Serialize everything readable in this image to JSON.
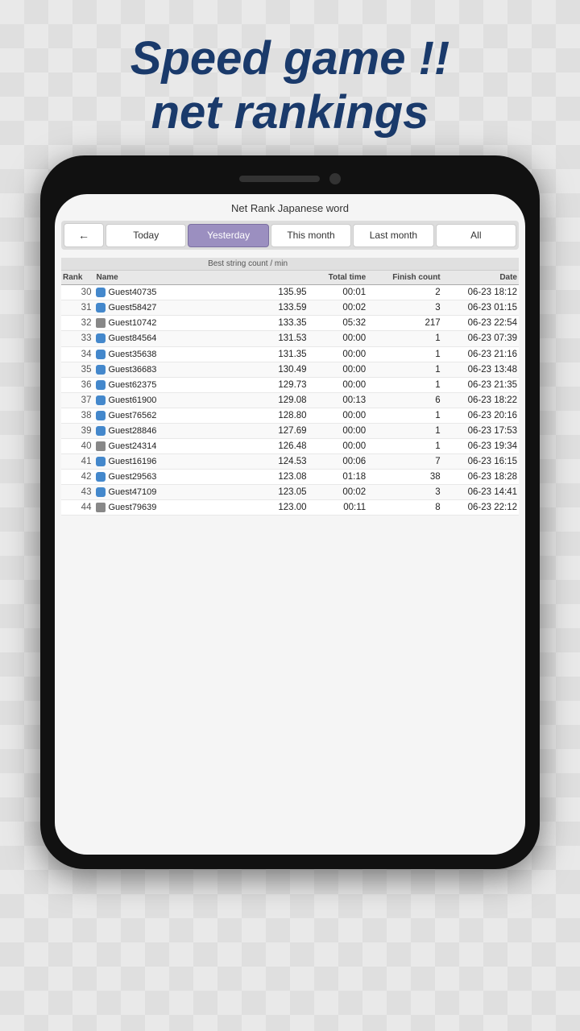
{
  "page": {
    "title_line1": "Speed game !!",
    "title_line2": "net rankings"
  },
  "screen": {
    "title": "Net Rank Japanese word",
    "back_label": "←",
    "tabs": [
      {
        "id": "today",
        "label": "Today",
        "active": false
      },
      {
        "id": "yesterday",
        "label": "Yesterday",
        "active": true
      },
      {
        "id": "this_month",
        "label": "This month",
        "active": false
      },
      {
        "id": "last_month",
        "label": "Last month",
        "active": false
      },
      {
        "id": "all",
        "label": "All",
        "active": false
      }
    ],
    "table": {
      "col_headers_top": [
        "",
        "",
        "Best string count / min",
        "",
        "",
        ""
      ],
      "col_headers": [
        "Rank",
        "Name",
        "",
        "Total time",
        "Finish count",
        "Date"
      ],
      "rows": [
        {
          "rank": "30",
          "device": "blue",
          "name": "Guest40735",
          "score": "135.95",
          "time": "00:01",
          "count": "2",
          "date": "06-23 18:12"
        },
        {
          "rank": "31",
          "device": "blue",
          "name": "Guest58427",
          "score": "133.59",
          "time": "00:02",
          "count": "3",
          "date": "06-23 01:15"
        },
        {
          "rank": "32",
          "device": "gray",
          "name": "Guest10742",
          "score": "133.35",
          "time": "05:32",
          "count": "217",
          "date": "06-23 22:54"
        },
        {
          "rank": "33",
          "device": "blue",
          "name": "Guest84564",
          "score": "131.53",
          "time": "00:00",
          "count": "1",
          "date": "06-23 07:39"
        },
        {
          "rank": "34",
          "device": "blue",
          "name": "Guest35638",
          "score": "131.35",
          "time": "00:00",
          "count": "1",
          "date": "06-23 21:16"
        },
        {
          "rank": "35",
          "device": "blue",
          "name": "Guest36683",
          "score": "130.49",
          "time": "00:00",
          "count": "1",
          "date": "06-23 13:48"
        },
        {
          "rank": "36",
          "device": "blue",
          "name": "Guest62375",
          "score": "129.73",
          "time": "00:00",
          "count": "1",
          "date": "06-23 21:35"
        },
        {
          "rank": "37",
          "device": "blue",
          "name": "Guest61900",
          "score": "129.08",
          "time": "00:13",
          "count": "6",
          "date": "06-23 18:22"
        },
        {
          "rank": "38",
          "device": "blue",
          "name": "Guest76562",
          "score": "128.80",
          "time": "00:00",
          "count": "1",
          "date": "06-23 20:16"
        },
        {
          "rank": "39",
          "device": "blue",
          "name": "Guest28846",
          "score": "127.69",
          "time": "00:00",
          "count": "1",
          "date": "06-23 17:53"
        },
        {
          "rank": "40",
          "device": "gray",
          "name": "Guest24314",
          "score": "126.48",
          "time": "00:00",
          "count": "1",
          "date": "06-23 19:34"
        },
        {
          "rank": "41",
          "device": "blue",
          "name": "Guest16196",
          "score": "124.53",
          "time": "00:06",
          "count": "7",
          "date": "06-23 16:15"
        },
        {
          "rank": "42",
          "device": "blue",
          "name": "Guest29563",
          "score": "123.08",
          "time": "01:18",
          "count": "38",
          "date": "06-23 18:28"
        },
        {
          "rank": "43",
          "device": "blue",
          "name": "Guest47109",
          "score": "123.05",
          "time": "00:02",
          "count": "3",
          "date": "06-23 14:41"
        },
        {
          "rank": "44",
          "device": "gray",
          "name": "Guest79639",
          "score": "123.00",
          "time": "00:11",
          "count": "8",
          "date": "06-23 22:12"
        }
      ]
    }
  }
}
